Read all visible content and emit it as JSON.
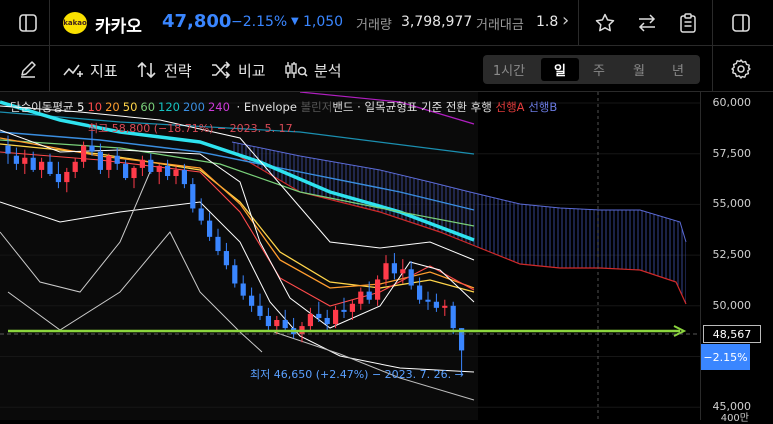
{
  "header": {
    "logo_text": "kakao",
    "stock_name": "카카오",
    "price": "47,800",
    "change_pct": "−2.15%",
    "change_arrow": "▼",
    "change_amt": "1,050",
    "volume_label": "거래량",
    "volume": "3,798,977",
    "value_label": "거래대금",
    "value_partial": "1.8",
    "more": "›"
  },
  "toolbar": {
    "indicator": "지표",
    "strategy": "전략",
    "compare": "비교",
    "analysis": "분석"
  },
  "timeframes": [
    "1시간",
    "일",
    "주",
    "월",
    "년"
  ],
  "timeframe_selected": "일",
  "legend": {
    "sma_label": "단순이동평균",
    "periods": [
      {
        "v": "5",
        "c": "#ffffff"
      },
      {
        "v": "10",
        "c": "#ff4b4b"
      },
      {
        "v": "20",
        "c": "#ff9d2e"
      },
      {
        "v": "50",
        "c": "#ffd54a"
      },
      {
        "v": "60",
        "c": "#7ad17a"
      },
      {
        "v": "120",
        "c": "#16c3c3"
      },
      {
        "v": "200",
        "c": "#3a8ee0"
      },
      {
        "v": "240",
        "c": "#cc3ad6"
      }
    ],
    "envelope": "· Envelope",
    "bb_prefix": "볼린저",
    "bb": "밴드",
    "ichimoku": "· 일목균형표",
    "base": "기준",
    "conv": "전환",
    "lag": "후행",
    "spanA": "선행A",
    "spanB": "선행B"
  },
  "annotations": {
    "high": "최고 58,800 (−18.71%) − 2023. 5. 17.",
    "low": "최저 46,650 (+2.47%) − 2023. 7. 26. →"
  },
  "price_axis": {
    "ticks": [
      "60,000",
      "57,500",
      "55,000",
      "52,500",
      "50,000",
      "47,500",
      "45,000"
    ],
    "guide_price": "48,567",
    "last_pct": "−2.15%",
    "vol_label": "400만"
  },
  "colors": {
    "up": "#ff3b4a",
    "down": "#3a86ff",
    "accent": "#8bd53e",
    "cyan": "#2fe3ef"
  }
}
